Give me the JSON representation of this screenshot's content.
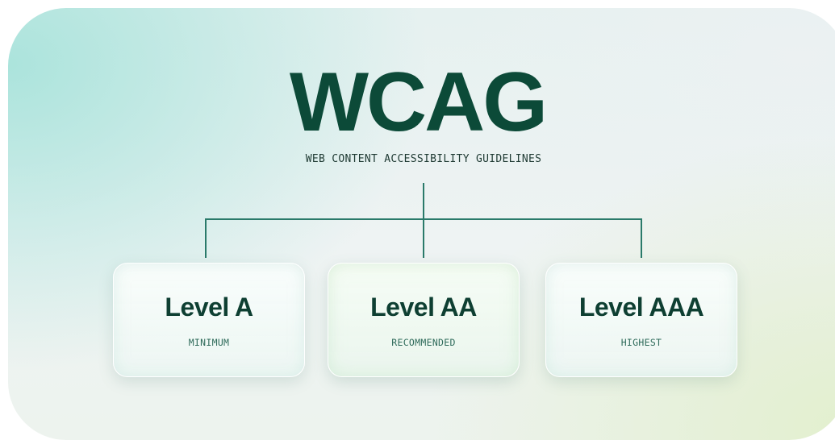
{
  "diagram": {
    "title": "WCAG",
    "subtitle": "WEB CONTENT ACCESSIBILITY GUIDELINES",
    "levels": [
      {
        "name": "Level A",
        "description": "MINIMUM"
      },
      {
        "name": "Level AA",
        "description": "RECOMMENDED"
      },
      {
        "name": "Level AAA",
        "description": "HIGHEST"
      }
    ]
  },
  "colors": {
    "title": "#0c4a38",
    "connector": "#2a7a6a",
    "card_title": "#0e3f32",
    "card_subtitle": "#2f6b5b"
  }
}
